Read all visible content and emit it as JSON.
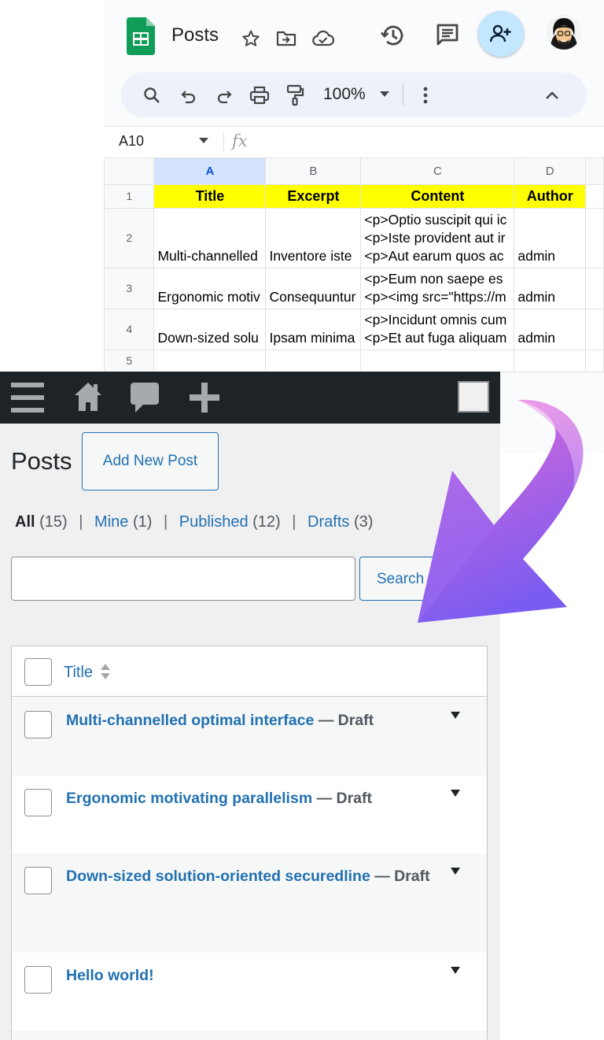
{
  "sheets": {
    "doc_title": "Posts",
    "zoom": "100%",
    "name_box": "A10",
    "fx_symbol": "fx",
    "columns": [
      "A",
      "B",
      "C",
      "D"
    ],
    "selected_column": "A",
    "row_numbers": [
      "1",
      "2",
      "3",
      "4",
      "5"
    ],
    "header_row": [
      "Title",
      "Excerpt",
      "Content",
      "Author"
    ],
    "rows": [
      {
        "title": "Multi-channelled",
        "excerpt": "Inventore iste",
        "content": [
          "<p>Optio suscipit qui ic",
          "<p>Iste provident aut ir",
          "<p>Aut earum quos ac"
        ],
        "author": "admin"
      },
      {
        "title": "Ergonomic motiv",
        "excerpt": "Consequuntur",
        "content": [
          "<p>Eum non saepe es",
          "<p><img src=\"https://m"
        ],
        "author": "admin"
      },
      {
        "title": "Down-sized solu",
        "excerpt": "Ipsam minima",
        "content": [
          "<p>Incidunt omnis cum",
          "<p>Et aut fuga aliquam"
        ],
        "author": "admin"
      }
    ],
    "colors": {
      "header_highlight": "#ffff00",
      "selected_col": "#d3e3fd",
      "logo": "#0f9d58",
      "share_bg": "#c2e7ff"
    },
    "icons": [
      "sheets-logo-icon",
      "star-icon",
      "move-folder-icon",
      "cloud-saved-icon",
      "history-icon",
      "comment-icon",
      "share-person-add-icon",
      "avatar",
      "search-icon",
      "undo-icon",
      "redo-icon",
      "print-icon",
      "paint-format-icon",
      "dropdown-caret-icon",
      "more-vert-icon",
      "collapse-chevron-icon"
    ]
  },
  "wp": {
    "page_title": "Posts",
    "add_new_label": "Add New Post",
    "filters": {
      "all": "All",
      "all_count": "(15)",
      "mine": "Mine",
      "mine_count": "(1)",
      "published": "Published",
      "published_count": "(12)",
      "drafts": "Drafts",
      "drafts_count": "(3)",
      "separator": "|"
    },
    "search_value": "",
    "search_button": "Search Posts",
    "column_title": "Title",
    "posts": [
      {
        "title": "Multi-channelled optimal interface",
        "state": "— Draft"
      },
      {
        "title": "Ergonomic motivating parallelism",
        "state": "— Draft"
      },
      {
        "title": "Down-sized solution-oriented securedline",
        "state": "— Draft"
      },
      {
        "title": "Hello world!",
        "state": ""
      }
    ],
    "colors": {
      "admin_bar": "#1d2327",
      "link": "#2271b1",
      "bg": "#f0f0f1"
    },
    "icons": [
      "menu-icon",
      "home-icon",
      "comment-bubble-icon",
      "plus-icon",
      "screen-options-square",
      "sort-icon",
      "row-actions-caret-icon"
    ]
  },
  "overlay": {
    "arrow_gradient": [
      "#e26ad6",
      "#7b5cf0"
    ]
  }
}
